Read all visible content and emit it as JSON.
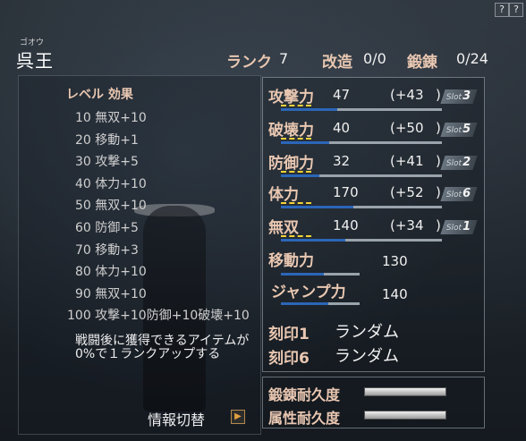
{
  "character": {
    "kana": "ゴオウ",
    "name": "呉王"
  },
  "header": {
    "rank_label": "ランク",
    "rank_value": "7",
    "kaizo_label": "改造",
    "kaizo_value": "0/0",
    "tanren_label": "鍛錬",
    "tanren_value": "0/24",
    "help_icons": [
      "?",
      "?"
    ]
  },
  "level_effects": {
    "title": "レベル 効果",
    "items": [
      "10 無双+10",
      "20 移動+1",
      "30 攻撃+5",
      "40 体力+10",
      "50 無双+10",
      "60 防御+5",
      "70 移動+3",
      "80 体力+10",
      "90 無双+10",
      "100 攻撃+10防御+10破壊+10"
    ],
    "note": "戦闘後に獲得できるアイテムが0%で１ランクアップする"
  },
  "stats": [
    {
      "label": "攻撃力",
      "value": "47",
      "bonus": "(+43",
      "close": ")",
      "slot_text": "Slot",
      "slot_num": "3",
      "bar_fill": 0.35
    },
    {
      "label": "破壊力",
      "value": "40",
      "bonus": "(+50",
      "close": ")",
      "slot_text": "Slot",
      "slot_num": "5",
      "bar_fill": 0.3
    },
    {
      "label": "防御力",
      "value": "32",
      "bonus": "(+41",
      "close": ")",
      "slot_text": "Slot",
      "slot_num": "2",
      "bar_fill": 0.24
    },
    {
      "label": "体力",
      "value": "170",
      "bonus": "(+52",
      "close": ")",
      "slot_text": "Slot",
      "slot_num": "6",
      "bar_fill": 0.45
    },
    {
      "label": "無双",
      "value": "140",
      "bonus": "(+34",
      "close": ")",
      "slot_text": "Slot",
      "slot_num": "1",
      "bar_fill": 0.4
    }
  ],
  "move": {
    "label": "移動力",
    "value": "130",
    "bar_fill": 0.55
  },
  "jump": {
    "label": "ジャンプ力",
    "value": "140",
    "bar_fill": 0.6
  },
  "kokuin": [
    {
      "label": "刻印1",
      "value": "ランダム"
    },
    {
      "label": "刻印6",
      "value": "ランダム"
    }
  ],
  "durability": [
    {
      "label": "鍛錬耐久度",
      "fill": 1.0
    },
    {
      "label": "属性耐久度",
      "fill": 1.0
    }
  ],
  "info_switch": {
    "label": "情報切替",
    "arrow": "▶"
  },
  "colors": {
    "label": "#e9c7b1",
    "underline": "#f1d23a",
    "bar": "#2b66b8"
  }
}
